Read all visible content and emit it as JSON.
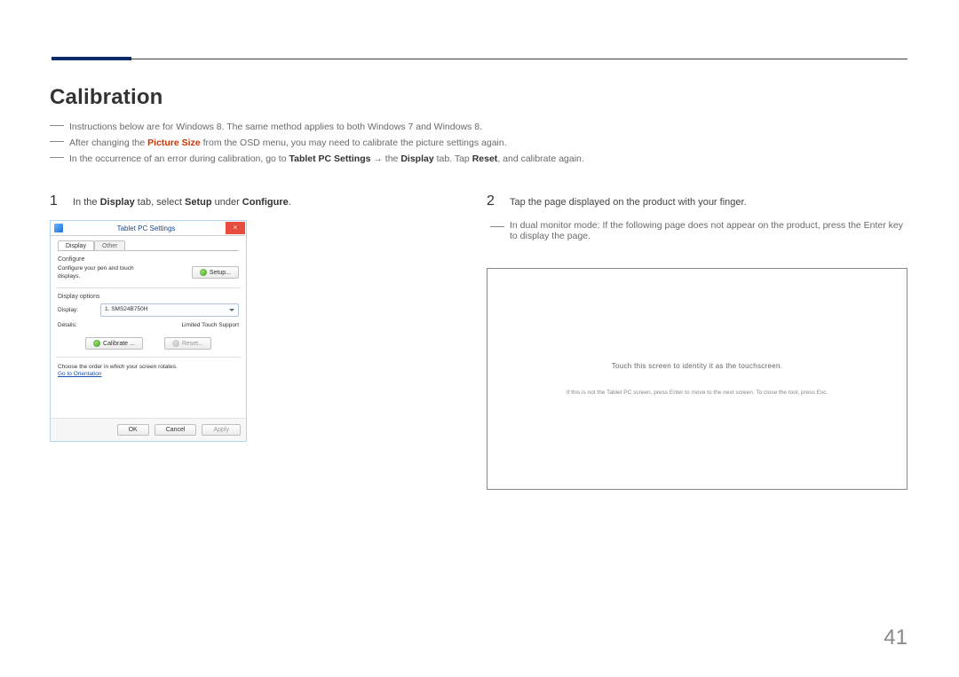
{
  "page": {
    "title": "Calibration",
    "number": "41"
  },
  "intro": {
    "line1": "Instructions below are for Windows 8. The same method applies to both Windows 7 and Windows 8.",
    "line2_prefix": "After changing the ",
    "line2_bold": "Picture Size",
    "line2_suffix": " from the OSD menu, you may need to calibrate the picture settings again.",
    "line3_prefix": "In the occurrence of an error during calibration, go to ",
    "line3_b1": "Tablet PC Settings",
    "line3_arrow": " → the ",
    "line3_b2": "Display",
    "line3_mid": " tab. Tap ",
    "line3_b3": "Reset",
    "line3_suffix": ", and calibrate again."
  },
  "steps": {
    "s1_num": "1",
    "s1_prefix": "In the ",
    "s1_b1": "Display",
    "s1_mid1": " tab, select ",
    "s1_b2": "Setup",
    "s1_mid2": " under ",
    "s1_b3": "Configure",
    "s1_suffix": ".",
    "s2_num": "2",
    "s2_text": "Tap the page displayed on the product with your finger.",
    "s2_note": "In dual monitor mode: If the following page does not appear on the product, press the Enter key to display the page."
  },
  "window": {
    "title": "Tablet PC Settings",
    "close": "×",
    "tabs": {
      "display": "Display",
      "other": "Other"
    },
    "configure": {
      "heading": "Configure",
      "desc": "Configure your pen and touch displays.",
      "setup_btn": "Setup..."
    },
    "display_options": {
      "heading": "Display options",
      "display_label": "Display:",
      "display_value": "1. SMS24B750H",
      "details_label": "Details:",
      "details_value": "Limited Touch Support",
      "calibrate_btn": "Calibrate ...",
      "reset_btn": "Reset..."
    },
    "rotate": {
      "desc": "Choose the order in which your screen rotates.",
      "link": "Go to Orientation"
    },
    "footer": {
      "ok": "OK",
      "cancel": "Cancel",
      "apply": "Apply"
    }
  },
  "touch_panel": {
    "line1": "Touch this screen to identity it as the touchscreen.",
    "line2": "If this is not the Tablet PC screen, press Enter to move to the next screen. To close the tool, press Esc."
  }
}
